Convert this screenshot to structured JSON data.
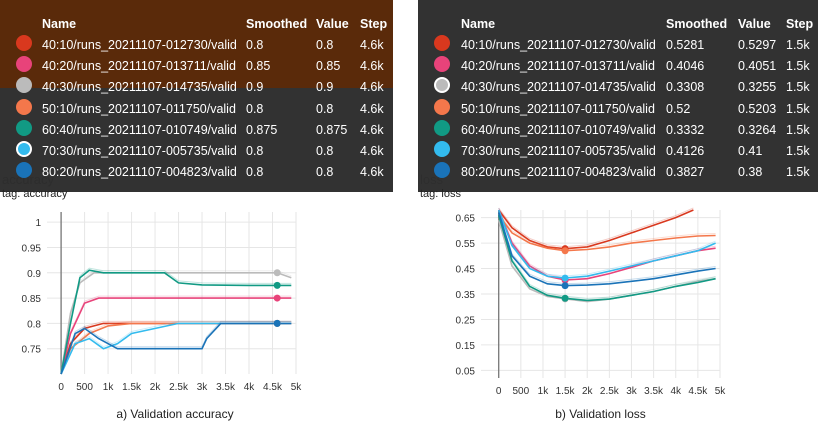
{
  "tooltip_header": {
    "name": "Name",
    "smoothed": "Smoothed",
    "value": "Value",
    "step": "Step"
  },
  "panels": [
    {
      "tag": "tag: accuracy",
      "caption": "a) Validation accuracy",
      "behind_text": "accuracy",
      "rows": [
        {
          "name": "40:10/runs_20211107-012730/valid",
          "smoothed": "0.8",
          "value": "0.8",
          "step": "4.6k",
          "color": "#d9381e",
          "ring": false
        },
        {
          "name": "40:20/runs_20211107-013711/valid",
          "smoothed": "0.85",
          "value": "0.85",
          "step": "4.6k",
          "color": "#e8437a",
          "ring": false
        },
        {
          "name": "40:30/runs_20211107-014735/valid",
          "smoothed": "0.9",
          "value": "0.9",
          "step": "4.6k",
          "color": "#bbbbbb",
          "ring": false
        },
        {
          "name": "50:10/runs_20211107-011750/valid",
          "smoothed": "0.8",
          "value": "0.8",
          "step": "4.6k",
          "color": "#f4774b",
          "ring": false
        },
        {
          "name": "60:40/runs_20211107-010749/valid",
          "smoothed": "0.875",
          "value": "0.875",
          "step": "4.6k",
          "color": "#119a84",
          "ring": false
        },
        {
          "name": "70:30/runs_20211107-005735/valid",
          "smoothed": "0.8",
          "value": "0.8",
          "step": "4.6k",
          "color": "#33bbee",
          "ring": true
        },
        {
          "name": "80:20/runs_20211107-004823/valid",
          "smoothed": "0.8",
          "value": "0.8",
          "step": "4.6k",
          "color": "#1a73b8",
          "ring": false
        }
      ]
    },
    {
      "tag": "tag: loss",
      "caption": "b) Validation loss",
      "behind_text": "loss",
      "rows": [
        {
          "name": "40:10/runs_20211107-012730/valid",
          "smoothed": "0.5281",
          "value": "0.5297",
          "step": "1.5k",
          "color": "#d9381e",
          "ring": false
        },
        {
          "name": "40:20/runs_20211107-013711/valid",
          "smoothed": "0.4046",
          "value": "0.4051",
          "step": "1.5k",
          "color": "#e8437a",
          "ring": false
        },
        {
          "name": "40:30/runs_20211107-014735/valid",
          "smoothed": "0.3308",
          "value": "0.3255",
          "step": "1.5k",
          "color": "#bbbbbb",
          "ring": true
        },
        {
          "name": "50:10/runs_20211107-011750/valid",
          "smoothed": "0.52",
          "value": "0.5203",
          "step": "1.5k",
          "color": "#f4774b",
          "ring": false
        },
        {
          "name": "60:40/runs_20211107-010749/valid",
          "smoothed": "0.3332",
          "value": "0.3264",
          "step": "1.5k",
          "color": "#119a84",
          "ring": false
        },
        {
          "name": "70:30/runs_20211107-005735/valid",
          "smoothed": "0.4126",
          "value": "0.41",
          "step": "1.5k",
          "color": "#33bbee",
          "ring": false
        },
        {
          "name": "80:20/runs_20211107-004823/valid",
          "smoothed": "0.3827",
          "value": "0.38",
          "step": "1.5k",
          "color": "#1a73b8",
          "ring": false
        }
      ]
    }
  ],
  "chart_data": [
    {
      "type": "line",
      "title": "",
      "xlabel": "",
      "ylabel": "",
      "xlim": [
        -300,
        5000
      ],
      "ylim": [
        0.7,
        1.02
      ],
      "xticks": [
        0,
        500,
        1000,
        1500,
        2000,
        2500,
        3000,
        3500,
        4000,
        4500,
        5000
      ],
      "xtick_labels": [
        "0",
        "500",
        "1k",
        "1.5k",
        "2k",
        "2.5k",
        "3k",
        "3.5k",
        "4k",
        "4.5k",
        "5k"
      ],
      "yticks": [
        0.75,
        0.8,
        0.85,
        0.9,
        0.95,
        1
      ],
      "ytick_labels": [
        "0.75",
        "0.8",
        "0.85",
        "0.9",
        "0.95",
        "1"
      ],
      "grid": true,
      "cursor_step": 4600,
      "series": [
        {
          "name": "40:10/runs_20211107-012730/valid",
          "color": "#d9381e",
          "x": [
            0,
            200,
            500,
            900,
            1500,
            2500,
            3500,
            4600,
            4900
          ],
          "y": [
            0.7,
            0.76,
            0.79,
            0.8,
            0.8,
            0.8,
            0.8,
            0.8,
            0.8
          ]
        },
        {
          "name": "40:20/runs_20211107-013711/valid",
          "color": "#e8437a",
          "x": [
            0,
            200,
            500,
            800,
            1500,
            2500,
            3500,
            4600,
            4900
          ],
          "y": [
            0.7,
            0.78,
            0.84,
            0.85,
            0.85,
            0.85,
            0.85,
            0.85,
            0.85
          ]
        },
        {
          "name": "40:30/runs_20211107-014735/valid",
          "color": "#bbbbbb",
          "x": [
            0,
            200,
            400,
            700,
            1200,
            2000,
            3000,
            4000,
            4600,
            4900
          ],
          "y": [
            0.7,
            0.82,
            0.88,
            0.9,
            0.9,
            0.9,
            0.9,
            0.9,
            0.9,
            0.89
          ]
        },
        {
          "name": "50:10/runs_20211107-011750/valid",
          "color": "#f4774b",
          "x": [
            0,
            200,
            600,
            1000,
            1500,
            2500,
            3500,
            4600,
            4900
          ],
          "y": [
            0.7,
            0.75,
            0.78,
            0.795,
            0.8,
            0.8,
            0.8,
            0.8,
            0.8
          ]
        },
        {
          "name": "60:40/runs_20211107-010749/valid",
          "color": "#119a84",
          "x": [
            0,
            200,
            400,
            600,
            900,
            1500,
            2200,
            2500,
            3000,
            4000,
            4600,
            4900
          ],
          "y": [
            0.7,
            0.8,
            0.89,
            0.905,
            0.9,
            0.9,
            0.9,
            0.88,
            0.876,
            0.875,
            0.875,
            0.875
          ]
        },
        {
          "name": "70:30/runs_20211107-005735/valid",
          "color": "#33bbee",
          "x": [
            0,
            300,
            600,
            900,
            1200,
            1500,
            2500,
            3500,
            4000,
            4600,
            4900
          ],
          "y": [
            0.7,
            0.76,
            0.77,
            0.75,
            0.76,
            0.78,
            0.8,
            0.8,
            0.8,
            0.8,
            0.8
          ]
        },
        {
          "name": "80:20/runs_20211107-004823/valid",
          "color": "#1a73b8",
          "x": [
            0,
            300,
            500,
            800,
            1200,
            2000,
            3000,
            3100,
            3400,
            4000,
            4600,
            4900
          ],
          "y": [
            0.7,
            0.78,
            0.79,
            0.77,
            0.75,
            0.75,
            0.75,
            0.77,
            0.8,
            0.8,
            0.8,
            0.8
          ]
        }
      ]
    },
    {
      "type": "line",
      "title": "",
      "xlabel": "",
      "ylabel": "",
      "xlim": [
        -400,
        5000
      ],
      "ylim": [
        0.02,
        0.68
      ],
      "xticks": [
        0,
        500,
        1000,
        1500,
        2000,
        2500,
        3000,
        3500,
        4000,
        4500,
        5000
      ],
      "xtick_labels": [
        "0",
        "500",
        "1k",
        "1.5k",
        "2k",
        "2.5k",
        "3k",
        "3.5k",
        "4k",
        "4.5k",
        "5k"
      ],
      "yticks": [
        0.05,
        0.15,
        0.25,
        0.35,
        0.45,
        0.55,
        0.65
      ],
      "ytick_labels": [
        "0.05",
        "0.15",
        "0.25",
        "0.35",
        "0.45",
        "0.55",
        "0.65"
      ],
      "grid": true,
      "cursor_step": 1500,
      "series": [
        {
          "name": "40:10/runs_20211107-012730/valid",
          "color": "#d9381e",
          "x": [
            0,
            300,
            700,
            1100,
            1500,
            2000,
            2500,
            3000,
            3500,
            4000,
            4400
          ],
          "y": [
            0.68,
            0.61,
            0.56,
            0.535,
            0.528,
            0.535,
            0.56,
            0.59,
            0.62,
            0.65,
            0.68
          ]
        },
        {
          "name": "40:20/runs_20211107-013711/valid",
          "color": "#e8437a",
          "x": [
            0,
            300,
            700,
            1100,
            1500,
            2000,
            2500,
            3000,
            3500,
            4000,
            4500,
            4900
          ],
          "y": [
            0.68,
            0.55,
            0.46,
            0.42,
            0.405,
            0.41,
            0.43,
            0.455,
            0.48,
            0.5,
            0.52,
            0.53
          ]
        },
        {
          "name": "40:30/runs_20211107-014735/valid",
          "color": "#bbbbbb",
          "x": [
            0,
            300,
            700,
            1100,
            1500,
            2000,
            2500,
            3000,
            3500,
            4000,
            4500,
            4900
          ],
          "y": [
            0.64,
            0.46,
            0.37,
            0.34,
            0.331,
            0.32,
            0.33,
            0.345,
            0.36,
            0.38,
            0.4,
            0.41
          ]
        },
        {
          "name": "50:10/runs_20211107-011750/valid",
          "color": "#f4774b",
          "x": [
            0,
            300,
            700,
            1100,
            1500,
            2000,
            2500,
            3000,
            3500,
            4000,
            4500,
            4900
          ],
          "y": [
            0.66,
            0.59,
            0.55,
            0.53,
            0.52,
            0.525,
            0.535,
            0.55,
            0.56,
            0.57,
            0.578,
            0.58
          ]
        },
        {
          "name": "60:40/runs_20211107-010749/valid",
          "color": "#119a84",
          "x": [
            0,
            300,
            700,
            1100,
            1500,
            2000,
            2500,
            3000,
            3500,
            4000,
            4500,
            4900
          ],
          "y": [
            0.66,
            0.48,
            0.38,
            0.345,
            0.333,
            0.325,
            0.33,
            0.345,
            0.36,
            0.38,
            0.395,
            0.41
          ]
        },
        {
          "name": "70:30/runs_20211107-005735/valid",
          "color": "#33bbee",
          "x": [
            0,
            300,
            700,
            1100,
            1500,
            2000,
            2500,
            3000,
            3500,
            4000,
            4500,
            4900
          ],
          "y": [
            0.68,
            0.54,
            0.45,
            0.42,
            0.413,
            0.42,
            0.44,
            0.46,
            0.48,
            0.5,
            0.52,
            0.55
          ]
        },
        {
          "name": "80:20/runs_20211107-004823/valid",
          "color": "#1a73b8",
          "x": [
            0,
            300,
            700,
            1100,
            1500,
            2000,
            2500,
            3000,
            3500,
            4000,
            4500,
            4900
          ],
          "y": [
            0.67,
            0.5,
            0.42,
            0.39,
            0.383,
            0.385,
            0.39,
            0.4,
            0.41,
            0.425,
            0.44,
            0.45
          ]
        }
      ]
    }
  ]
}
